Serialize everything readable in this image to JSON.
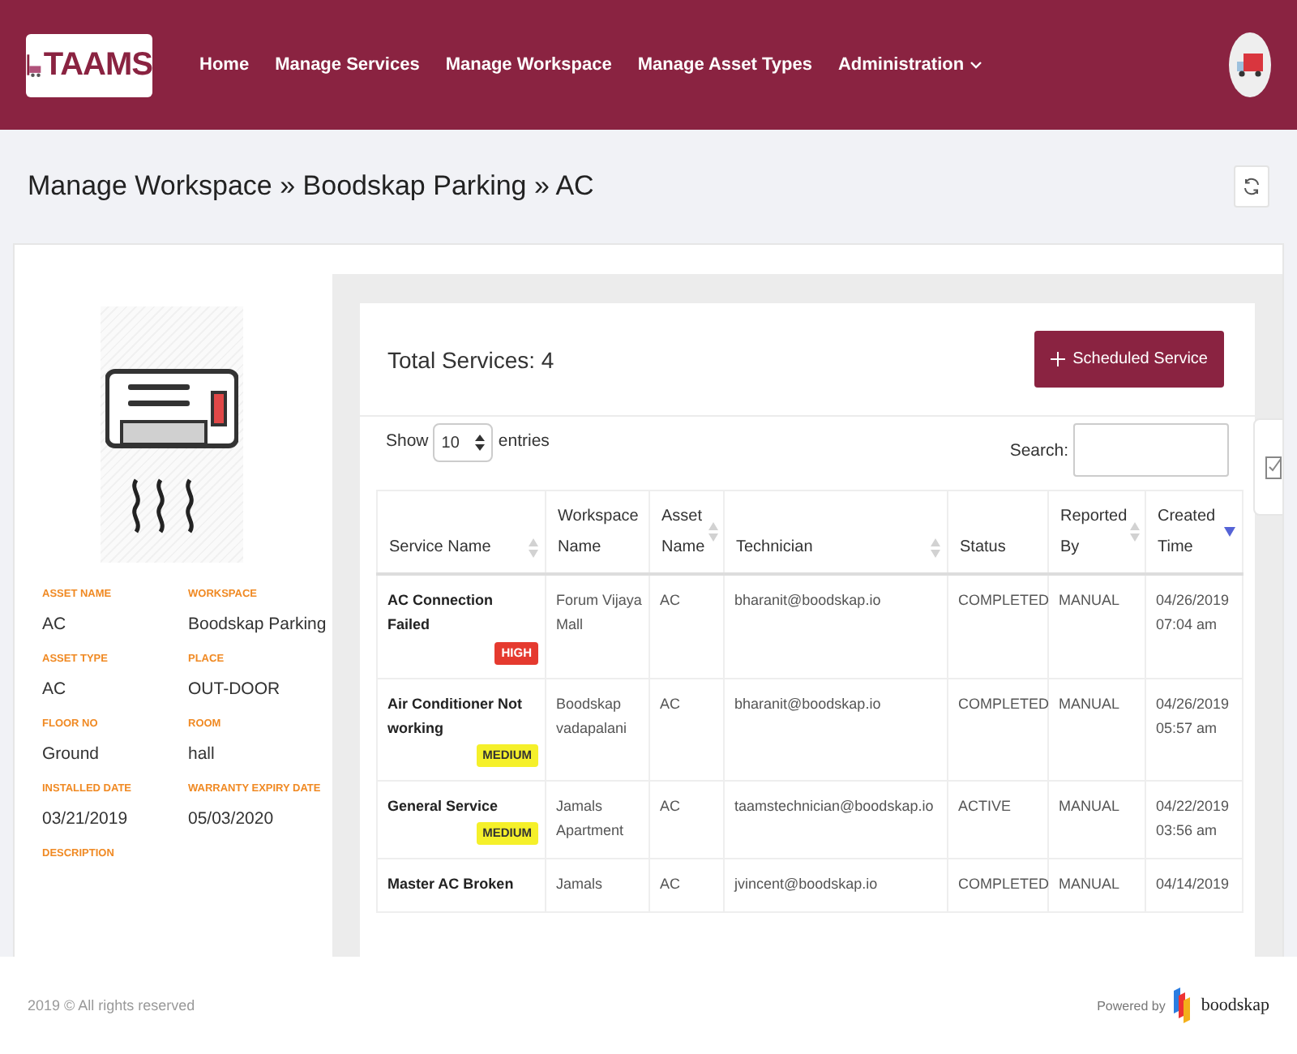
{
  "header": {
    "logo_text": "TAAMS",
    "nav": [
      {
        "label": "Home",
        "dropdown": false
      },
      {
        "label": "Manage Services",
        "dropdown": false
      },
      {
        "label": "Manage Workspace",
        "dropdown": false
      },
      {
        "label": "Manage Asset Types",
        "dropdown": false
      },
      {
        "label": "Administration",
        "dropdown": true
      }
    ]
  },
  "breadcrumb": "Manage Workspace » Boodskap Parking » AC",
  "asset": {
    "fields": [
      {
        "label": "ASSET NAME",
        "value": "AC"
      },
      {
        "label": "WORKSPACE",
        "value": "Boodskap Parking"
      },
      {
        "label": "ASSET TYPE",
        "value": "AC"
      },
      {
        "label": "PLACE",
        "value": "OUT-DOOR"
      },
      {
        "label": "FLOOR NO",
        "value": "Ground"
      },
      {
        "label": "ROOM",
        "value": "hall"
      },
      {
        "label": "INSTALLED DATE",
        "value": "03/21/2019"
      },
      {
        "label": "WARRANTY EXPIRY DATE",
        "value": "05/03/2020"
      },
      {
        "label": "DESCRIPTION"
      }
    ]
  },
  "services": {
    "title": "Total Services: 4",
    "add_button": "Scheduled Service",
    "show_label": "Show",
    "page_size": "10",
    "entries_label": "entries",
    "search_label": "Search:",
    "columns": [
      {
        "label": "Service Name",
        "sortable": true,
        "sorted": false
      },
      {
        "label": "Workspace Name",
        "sortable": false,
        "sorted": false
      },
      {
        "label": "Asset Name",
        "sortable": true,
        "sorted": false
      },
      {
        "label": "Technician",
        "sortable": true,
        "sorted": false
      },
      {
        "label": "Status",
        "sortable": false,
        "sorted": false
      },
      {
        "label": "Reported By",
        "sortable": true,
        "sorted": false
      },
      {
        "label": "Created Time",
        "sortable": true,
        "sorted": true
      }
    ],
    "rows": [
      {
        "service": "AC Connection Failed",
        "priority": {
          "label": "HIGH",
          "color": "#e53a2f"
        },
        "workspace": "Forum Vijaya Mall",
        "asset": "AC",
        "technician": "bharanit@boodskap.io",
        "status": "COMPLETED",
        "reported_by": "MANUAL",
        "created": "04/26/2019 07:04 am"
      },
      {
        "service": "Air Conditioner Not working",
        "priority": {
          "label": "MEDIUM",
          "color": "#f5f02a"
        },
        "workspace": "Boodskap vadapalani",
        "asset": "AC",
        "technician": "bharanit@boodskap.io",
        "status": "COMPLETED",
        "reported_by": "MANUAL",
        "created": "04/26/2019 05:57 am"
      },
      {
        "service": "General Service",
        "priority": {
          "label": "MEDIUM",
          "color": "#f5f02a"
        },
        "workspace": "Jamals Apartment",
        "asset": "AC",
        "technician": "taamstechnician@boodskap.io",
        "status": "ACTIVE",
        "reported_by": "MANUAL",
        "created": "04/22/2019 03:56 am"
      },
      {
        "service": "Master AC Broken",
        "workspace": "Jamals",
        "asset": "AC",
        "technician": "jvincent@boodskap.io",
        "status": "COMPLETED",
        "reported_by": "MANUAL",
        "created": "04/14/2019"
      }
    ]
  },
  "footer": {
    "copyright": "2019 © All rights reserved",
    "powered_by": "Powered by",
    "brand": "boodskap"
  }
}
